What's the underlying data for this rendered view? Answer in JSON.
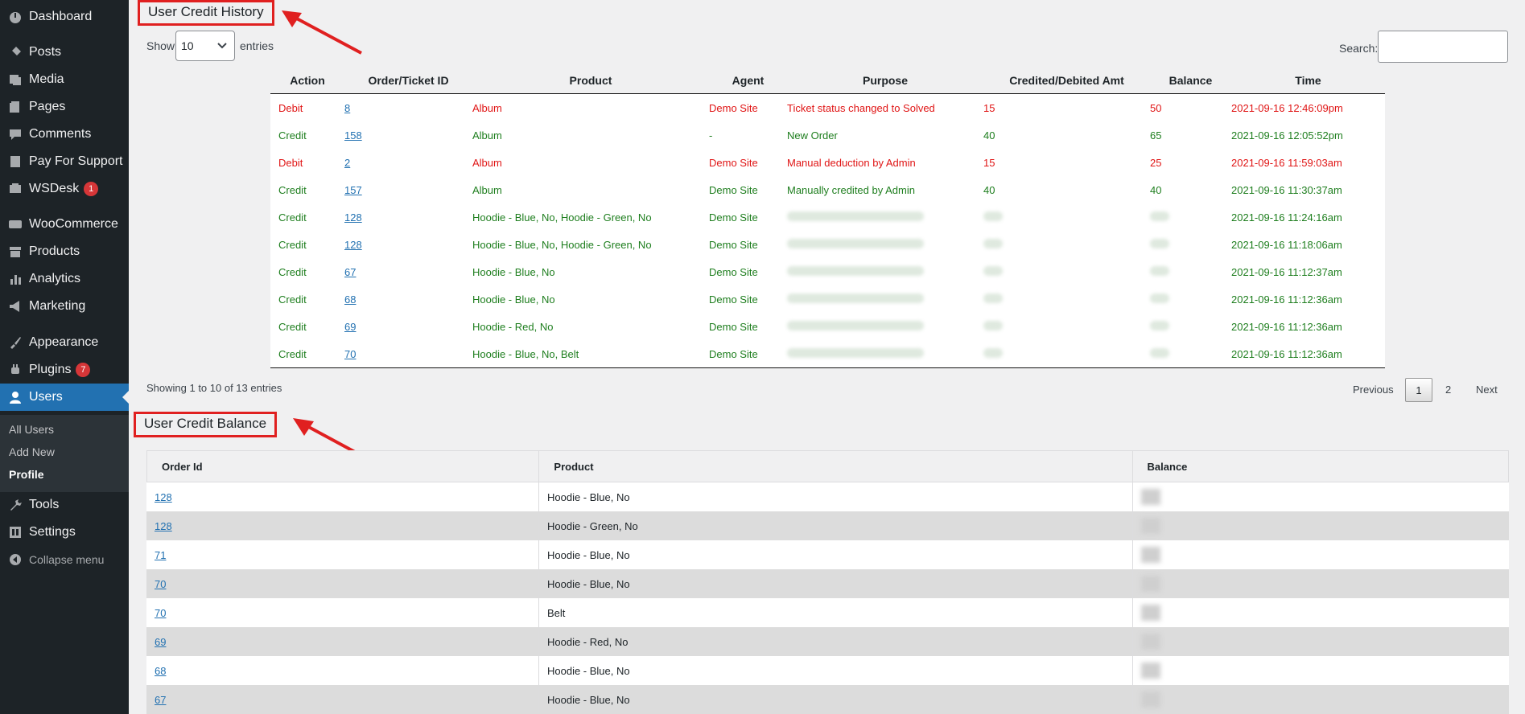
{
  "sidebar": {
    "items": [
      {
        "label": "Dashboard",
        "icon": "dashboard-icon"
      },
      {
        "label": "Posts",
        "icon": "pin-icon"
      },
      {
        "label": "Media",
        "icon": "media-icon"
      },
      {
        "label": "Pages",
        "icon": "pages-icon"
      },
      {
        "label": "Comments",
        "icon": "comment-icon"
      },
      {
        "label": "Pay For Support",
        "icon": "document-icon"
      },
      {
        "label": "WSDesk",
        "icon": "desk-icon",
        "badge": "1"
      },
      {
        "label": "WooCommerce",
        "icon": "woo-icon"
      },
      {
        "label": "Products",
        "icon": "archive-icon"
      },
      {
        "label": "Analytics",
        "icon": "chart-icon"
      },
      {
        "label": "Marketing",
        "icon": "megaphone-icon"
      },
      {
        "label": "Appearance",
        "icon": "brush-icon"
      },
      {
        "label": "Plugins",
        "icon": "plugin-icon",
        "badge": "7"
      },
      {
        "label": "Users",
        "icon": "user-icon"
      },
      {
        "label": "Tools",
        "icon": "wrench-icon"
      },
      {
        "label": "Settings",
        "icon": "settings-icon"
      },
      {
        "label": "Collapse menu",
        "icon": "collapse-icon"
      }
    ],
    "submenu": [
      "All Users",
      "Add New",
      "Profile"
    ]
  },
  "history": {
    "title": "User Credit History",
    "show_label": "Show",
    "entries_label": "entries",
    "page_length": "10",
    "search_label": "Search:",
    "columns": [
      "Action",
      "Order/Ticket ID",
      "Product",
      "Agent",
      "Purpose",
      "Credited/Debited Amt",
      "Balance",
      "Time"
    ],
    "rows": [
      {
        "action": "Debit",
        "order": "8",
        "product": "Album",
        "agent": "Demo Site",
        "purpose": "Ticket status changed to Solved",
        "amount": "15",
        "balance": "50",
        "time": "2021-09-16 12:46:09pm"
      },
      {
        "action": "Credit",
        "order": "158",
        "product": "Album",
        "agent": "-",
        "purpose": "New Order",
        "amount": "40",
        "balance": "65",
        "time": "2021-09-16 12:05:52pm"
      },
      {
        "action": "Debit",
        "order": "2",
        "product": "Album",
        "agent": "Demo Site",
        "purpose": "Manual deduction by Admin",
        "amount": "15",
        "balance": "25",
        "time": "2021-09-16 11:59:03am"
      },
      {
        "action": "Credit",
        "order": "157",
        "product": "Album",
        "agent": "Demo Site",
        "purpose": "Manually credited by Admin",
        "amount": "40",
        "balance": "40",
        "time": "2021-09-16 11:30:37am"
      },
      {
        "action": "Credit",
        "order": "128",
        "product": "Hoodie - Blue, No, Hoodie - Green, No",
        "agent": "Demo Site",
        "purpose": "",
        "amount": "",
        "balance": "",
        "time": "2021-09-16 11:24:16am"
      },
      {
        "action": "Credit",
        "order": "128",
        "product": "Hoodie - Blue, No, Hoodie - Green, No",
        "agent": "Demo Site",
        "purpose": "",
        "amount": "",
        "balance": "",
        "time": "2021-09-16 11:18:06am"
      },
      {
        "action": "Credit",
        "order": "67",
        "product": "Hoodie - Blue, No",
        "agent": "Demo Site",
        "purpose": "",
        "amount": "",
        "balance": "",
        "time": "2021-09-16 11:12:37am"
      },
      {
        "action": "Credit",
        "order": "68",
        "product": "Hoodie - Blue, No",
        "agent": "Demo Site",
        "purpose": "",
        "amount": "",
        "balance": "",
        "time": "2021-09-16 11:12:36am"
      },
      {
        "action": "Credit",
        "order": "69",
        "product": "Hoodie - Red, No",
        "agent": "Demo Site",
        "purpose": "",
        "amount": "",
        "balance": "",
        "time": "2021-09-16 11:12:36am"
      },
      {
        "action": "Credit",
        "order": "70",
        "product": "Hoodie - Blue, No, Belt",
        "agent": "Demo Site",
        "purpose": "",
        "amount": "",
        "balance": "",
        "time": "2021-09-16 11:12:36am"
      }
    ],
    "info": "Showing 1 to 10 of 13 entries",
    "pagination": {
      "previous": "Previous",
      "pages": [
        "1",
        "2"
      ],
      "next": "Next",
      "current": "1"
    }
  },
  "balance": {
    "title": "User Credit Balance",
    "columns": [
      "Order Id",
      "Product",
      "Balance"
    ],
    "rows": [
      {
        "order": "128",
        "product": "Hoodie - Blue, No"
      },
      {
        "order": "128",
        "product": "Hoodie - Green, No"
      },
      {
        "order": "71",
        "product": "Hoodie - Blue, No"
      },
      {
        "order": "70",
        "product": "Hoodie - Blue, No"
      },
      {
        "order": "70",
        "product": "Belt"
      },
      {
        "order": "69",
        "product": "Hoodie - Red, No"
      },
      {
        "order": "68",
        "product": "Hoodie - Blue, No"
      },
      {
        "order": "67",
        "product": "Hoodie - Blue, No"
      }
    ]
  },
  "colors": {
    "debit": "#e01515",
    "credit": "#1e7e1e",
    "highlight": "#e02020",
    "accent": "#2271b1"
  }
}
